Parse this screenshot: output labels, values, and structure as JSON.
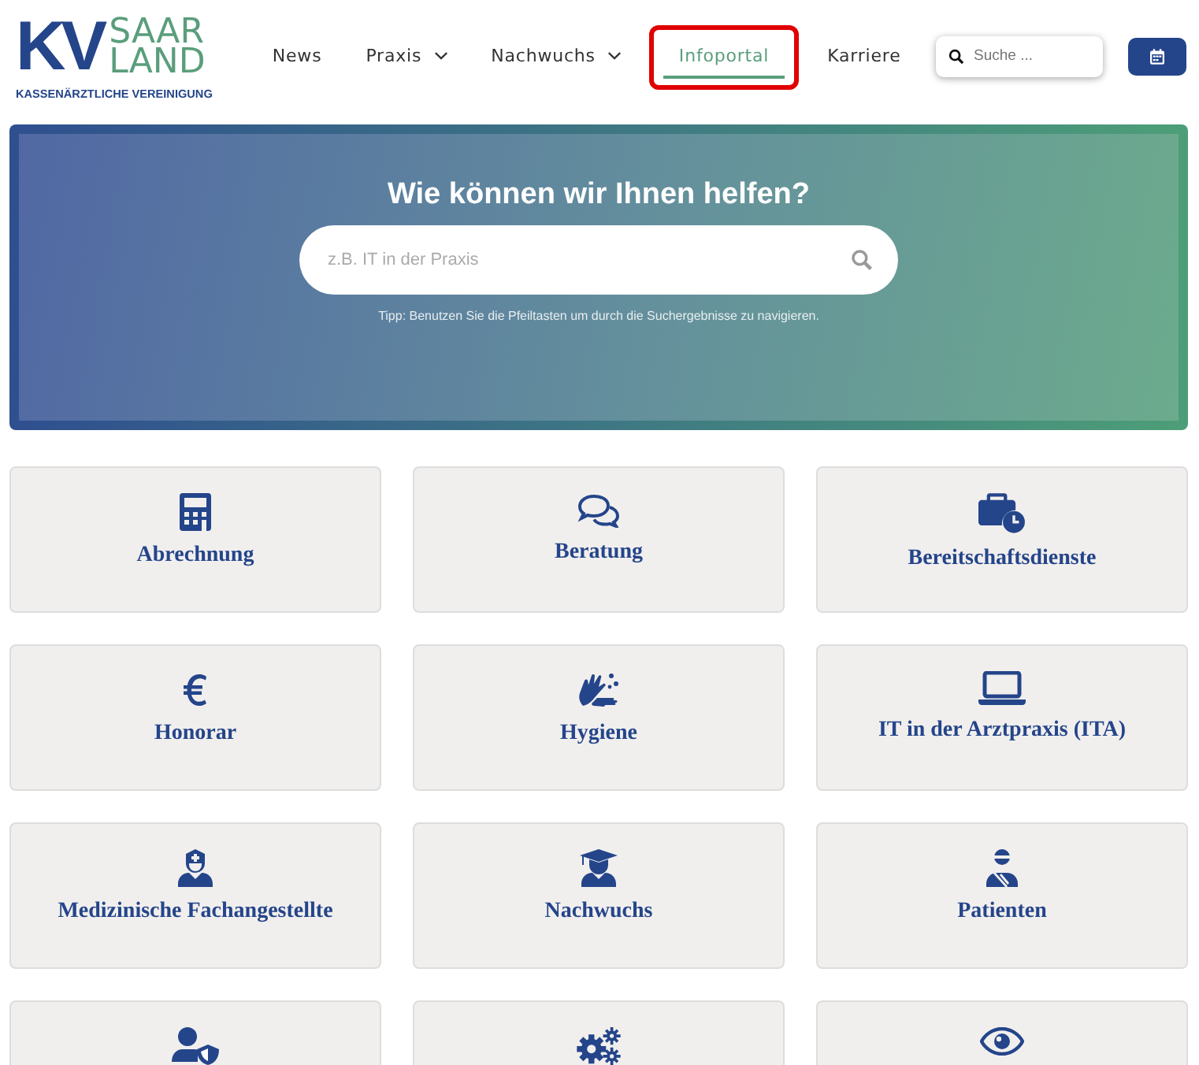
{
  "logo": {
    "mark": "KV",
    "line_1": "SAAR",
    "line_2": "LAND",
    "subtitle": "KASSENÄRZTLICHE VEREINIGUNG"
  },
  "nav": [
    {
      "label": "News",
      "dropdown": false,
      "selected": false,
      "highlighted": false
    },
    {
      "label": "Praxis",
      "dropdown": true,
      "selected": false,
      "highlighted": false
    },
    {
      "label": "Nachwuchs",
      "dropdown": true,
      "selected": false,
      "highlighted": false
    },
    {
      "label": "Infoportal",
      "dropdown": false,
      "selected": true,
      "highlighted": true
    },
    {
      "label": "Karriere",
      "dropdown": false,
      "selected": false,
      "highlighted": false
    }
  ],
  "header_search": {
    "placeholder": "Suche ..."
  },
  "hero": {
    "title": "Wie können wir Ihnen helfen?",
    "search_placeholder": "z.B. IT in der Praxis",
    "tip": "Tipp: Benutzen Sie die Pfeiltasten um durch die Suchergebnisse zu navigieren."
  },
  "categories": [
    {
      "kind": "titled",
      "label": "Abrechnung"
    },
    {
      "kind": "titled",
      "label": "Beratung"
    },
    {
      "kind": "titled",
      "label": "Bereitschaftsdienste"
    },
    {
      "kind": "titled",
      "label": "Honorar"
    },
    {
      "kind": "titled",
      "label": "Hygiene"
    },
    {
      "kind": "titled",
      "label": "IT in der Arztpraxis (ITA)"
    },
    {
      "kind": "titled",
      "label": "Medizinische Fachangestellte"
    },
    {
      "kind": "titled",
      "label": "Nachwuchs"
    },
    {
      "kind": "titled",
      "label": "Patienten"
    },
    {
      "kind": "icon_only"
    },
    {
      "kind": "icon_only"
    },
    {
      "kind": "icon_only"
    }
  ]
}
